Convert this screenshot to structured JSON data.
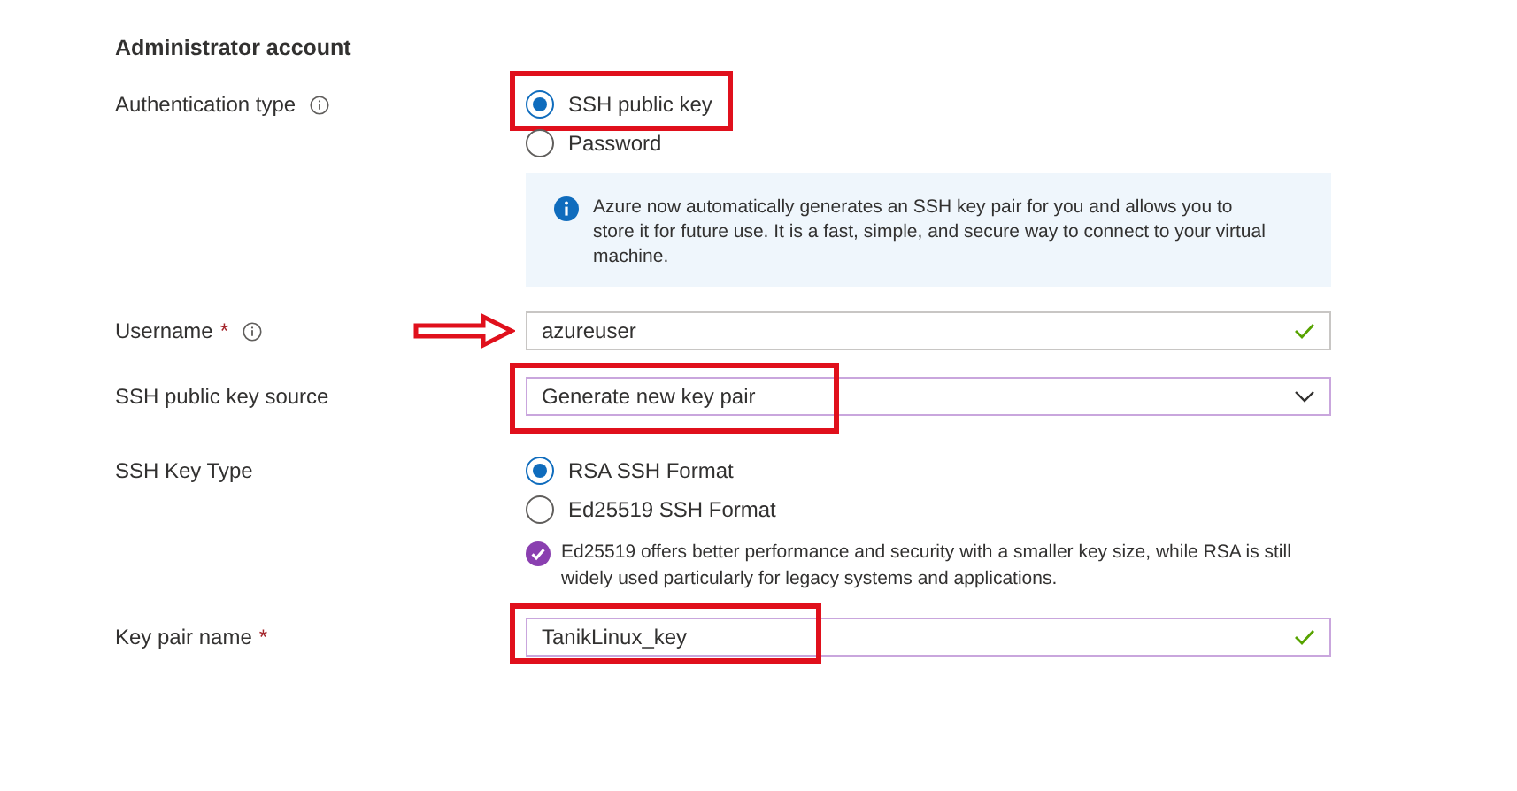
{
  "section_title": "Administrator account",
  "fields": [
    {
      "kind": "radio",
      "label": "Authentication type",
      "info": true,
      "options": [
        {
          "label": "SSH public key",
          "selected": true,
          "highlighted": true
        },
        {
          "label": "Password",
          "selected": false,
          "highlighted": false
        }
      ],
      "note": {
        "kind": "info",
        "text": "Azure now automatically generates an SSH key pair for you and allows you to store it for future use. It is a fast, simple, and secure way to connect to your virtual machine."
      }
    },
    {
      "kind": "text",
      "label": "Username",
      "required_mark": "*",
      "info": true,
      "value": "azureuser",
      "valid": true,
      "dirty": false,
      "arrow": true,
      "highlighted": false
    },
    {
      "kind": "select",
      "label": "SSH public key source",
      "info": false,
      "value": "Generate new key pair",
      "valid": false,
      "dirty": true,
      "arrow": false,
      "highlighted": true
    },
    {
      "kind": "radio",
      "label": "SSH Key Type",
      "info": false,
      "options": [
        {
          "label": "RSA SSH Format",
          "selected": true,
          "highlighted": false
        },
        {
          "label": "Ed25519 SSH Format",
          "selected": false,
          "highlighted": false
        }
      ],
      "note": {
        "kind": "tip",
        "text": "Ed25519 offers better performance and security with a smaller key size, while RSA is still widely used particularly for legacy systems and applications."
      }
    },
    {
      "kind": "text",
      "label": "Key pair name",
      "required_mark": "*",
      "info": false,
      "value": "TanikLinux_key",
      "valid": true,
      "dirty": true,
      "arrow": false,
      "highlighted": true
    }
  ]
}
